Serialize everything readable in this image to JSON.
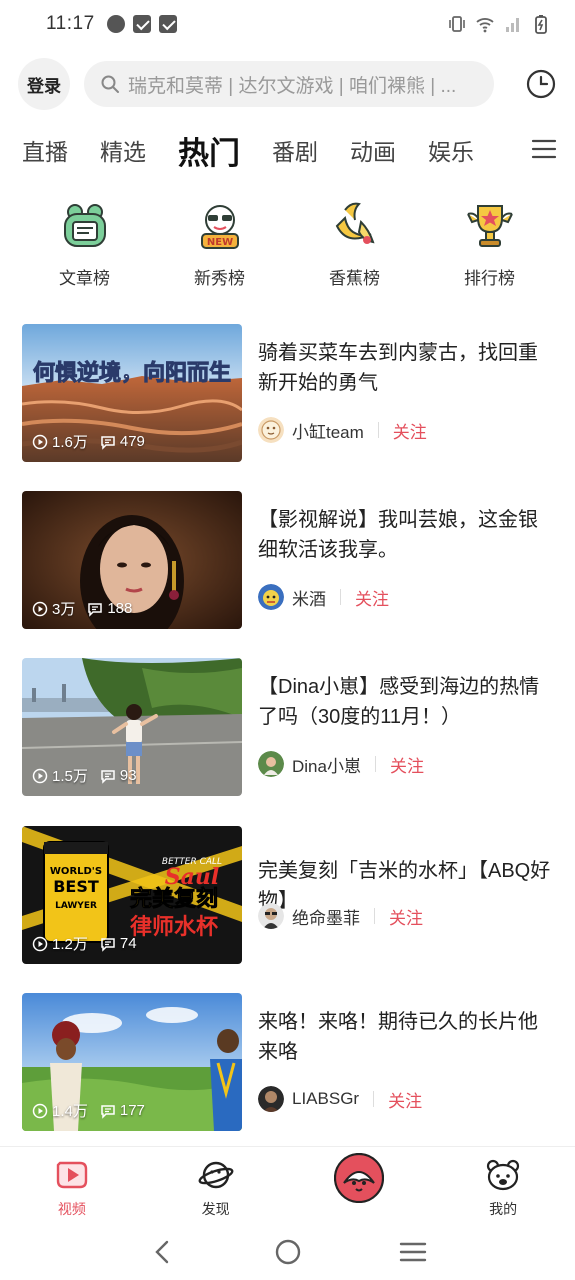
{
  "status": {
    "time": "11:17"
  },
  "header": {
    "login_label": "登录",
    "search_placeholder": "瑞克和莫蒂 | 达尔文游戏 | 咱们裸熊 | ..."
  },
  "tabs": [
    {
      "label": "直播"
    },
    {
      "label": "精选"
    },
    {
      "label": "热门",
      "active": true
    },
    {
      "label": "番剧"
    },
    {
      "label": "动画"
    },
    {
      "label": "娱乐"
    }
  ],
  "ranks": [
    {
      "label": "文章榜",
      "icon": "frog-article-icon"
    },
    {
      "label": "新秀榜",
      "icon": "new-star-icon"
    },
    {
      "label": "香蕉榜",
      "icon": "banana-icon"
    },
    {
      "label": "排行榜",
      "icon": "trophy-icon"
    }
  ],
  "videos": [
    {
      "title": "骑着买菜车去到内蒙古，找回重新开始的勇气",
      "thumb_text": "何惧逆境，向阳而生",
      "plays": "1.6万",
      "comments": "479",
      "author": "小缸team",
      "follow_label": "关注"
    },
    {
      "title": "【影视解说】我叫芸娘，这金银细软活该我享。",
      "plays": "3万",
      "comments": "188",
      "author": "米酒",
      "follow_label": "关注"
    },
    {
      "title": "【Dina小崽】感受到海边的热情了吗（30度的11月！）",
      "plays": "1.5万",
      "comments": "93",
      "author": "Dina小崽",
      "follow_label": "关注"
    },
    {
      "title": "完美复刻「吉米的水杯」【ABQ好物】",
      "thumb_text_1": "完美复刻",
      "thumb_text_2": "律师水杯",
      "thumb_cup_1": "WORLD'S",
      "thumb_cup_2": "BEST",
      "thumb_cup_3": "LAWYER",
      "thumb_logo_1": "BETTER CALL",
      "thumb_logo_2": "Saul",
      "plays": "1.2万",
      "comments": "74",
      "author": "绝命墨菲",
      "follow_label": "关注"
    },
    {
      "title": "来咯！来咯！期待已久的长片他来咯",
      "plays": "1.4万",
      "comments": "177",
      "author": "LIABSGr",
      "follow_label": "关注"
    }
  ],
  "bottom_nav": [
    {
      "label": "视频",
      "active": true
    },
    {
      "label": "发现"
    },
    {
      "label": ""
    },
    {
      "label": "我的"
    }
  ],
  "colors": {
    "accent": "#e4505d"
  }
}
